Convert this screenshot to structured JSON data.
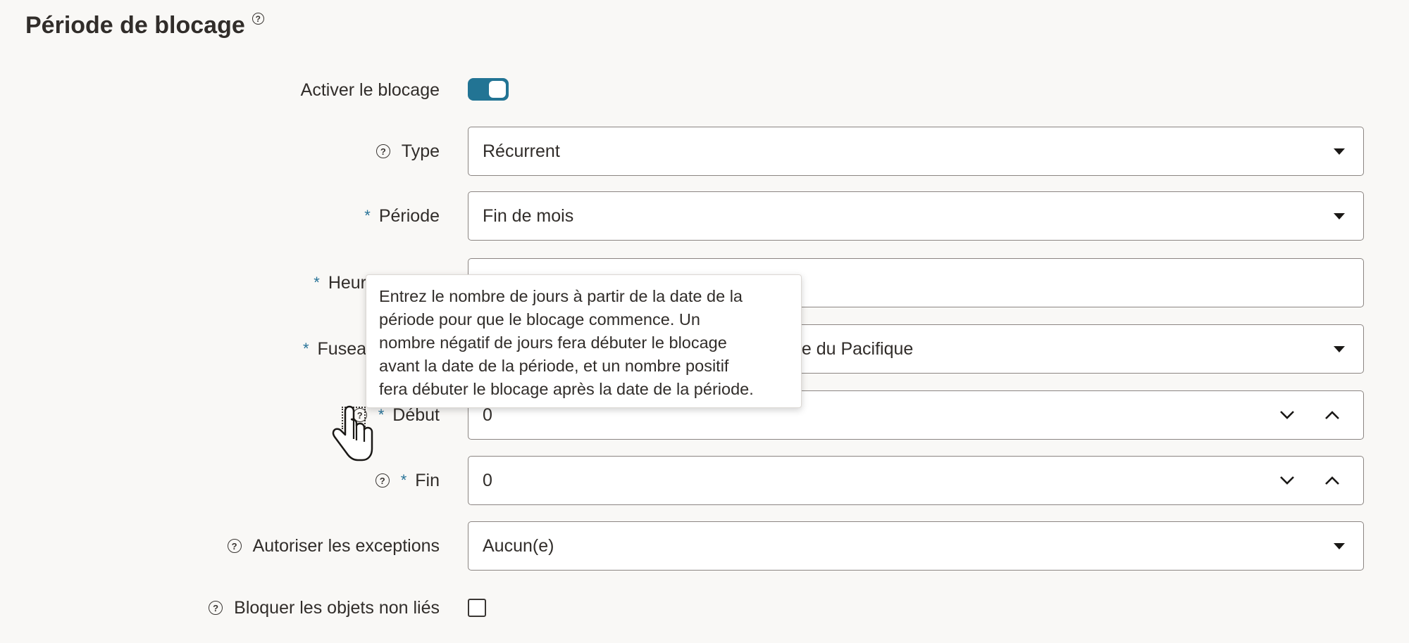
{
  "section": {
    "title": "Période de blocage",
    "help_icon": "question-circle-icon"
  },
  "fields": {
    "enable": {
      "label": "Activer le blocage",
      "checked": true,
      "accent": "#227494"
    },
    "type": {
      "label": "Type",
      "value": "Récurrent"
    },
    "period": {
      "label": "Période",
      "value": "Fin de mois"
    },
    "hour": {
      "label": "Heur",
      "value": ""
    },
    "timezone": {
      "label": "Fusea",
      "value": "tée du Pacifique"
    },
    "start": {
      "label": "Début",
      "value": "0"
    },
    "end": {
      "label": "Fin",
      "value": "0"
    },
    "exceptions": {
      "label": "Autoriser les exceptions",
      "value": "Aucun(e)"
    },
    "unlinked": {
      "label": "Bloquer les objets non liés",
      "checked": false
    }
  },
  "required_marker": "*",
  "tooltip": {
    "lines": [
      "Entrez le nombre de jours à partir de la date de la",
      "période pour que le blocage commence. Un",
      "nombre négatif de jours fera débuter le blocage",
      "avant la date de la période, et un nombre positif",
      "fera débuter le blocage après la date de la période."
    ]
  },
  "colors": {
    "required": "#287398",
    "toggle_on": "#227494",
    "background": "#f9f8f6"
  }
}
